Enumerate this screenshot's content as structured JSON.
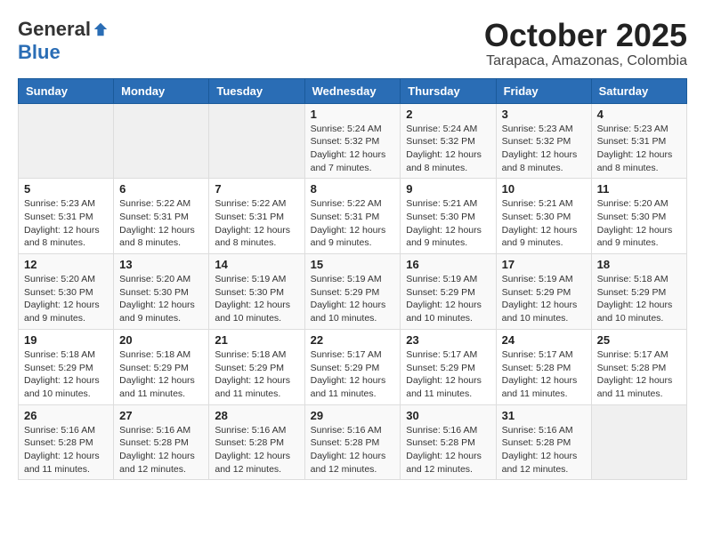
{
  "header": {
    "logo_general": "General",
    "logo_blue": "Blue",
    "month_title": "October 2025",
    "subtitle": "Tarapaca, Amazonas, Colombia"
  },
  "weekdays": [
    "Sunday",
    "Monday",
    "Tuesday",
    "Wednesday",
    "Thursday",
    "Friday",
    "Saturday"
  ],
  "weeks": [
    [
      {
        "day": "",
        "sunrise": "",
        "sunset": "",
        "daylight": ""
      },
      {
        "day": "",
        "sunrise": "",
        "sunset": "",
        "daylight": ""
      },
      {
        "day": "",
        "sunrise": "",
        "sunset": "",
        "daylight": ""
      },
      {
        "day": "1",
        "sunrise": "Sunrise: 5:24 AM",
        "sunset": "Sunset: 5:32 PM",
        "daylight": "Daylight: 12 hours and 7 minutes."
      },
      {
        "day": "2",
        "sunrise": "Sunrise: 5:24 AM",
        "sunset": "Sunset: 5:32 PM",
        "daylight": "Daylight: 12 hours and 8 minutes."
      },
      {
        "day": "3",
        "sunrise": "Sunrise: 5:23 AM",
        "sunset": "Sunset: 5:32 PM",
        "daylight": "Daylight: 12 hours and 8 minutes."
      },
      {
        "day": "4",
        "sunrise": "Sunrise: 5:23 AM",
        "sunset": "Sunset: 5:31 PM",
        "daylight": "Daylight: 12 hours and 8 minutes."
      }
    ],
    [
      {
        "day": "5",
        "sunrise": "Sunrise: 5:23 AM",
        "sunset": "Sunset: 5:31 PM",
        "daylight": "Daylight: 12 hours and 8 minutes."
      },
      {
        "day": "6",
        "sunrise": "Sunrise: 5:22 AM",
        "sunset": "Sunset: 5:31 PM",
        "daylight": "Daylight: 12 hours and 8 minutes."
      },
      {
        "day": "7",
        "sunrise": "Sunrise: 5:22 AM",
        "sunset": "Sunset: 5:31 PM",
        "daylight": "Daylight: 12 hours and 8 minutes."
      },
      {
        "day": "8",
        "sunrise": "Sunrise: 5:22 AM",
        "sunset": "Sunset: 5:31 PM",
        "daylight": "Daylight: 12 hours and 9 minutes."
      },
      {
        "day": "9",
        "sunrise": "Sunrise: 5:21 AM",
        "sunset": "Sunset: 5:30 PM",
        "daylight": "Daylight: 12 hours and 9 minutes."
      },
      {
        "day": "10",
        "sunrise": "Sunrise: 5:21 AM",
        "sunset": "Sunset: 5:30 PM",
        "daylight": "Daylight: 12 hours and 9 minutes."
      },
      {
        "day": "11",
        "sunrise": "Sunrise: 5:20 AM",
        "sunset": "Sunset: 5:30 PM",
        "daylight": "Daylight: 12 hours and 9 minutes."
      }
    ],
    [
      {
        "day": "12",
        "sunrise": "Sunrise: 5:20 AM",
        "sunset": "Sunset: 5:30 PM",
        "daylight": "Daylight: 12 hours and 9 minutes."
      },
      {
        "day": "13",
        "sunrise": "Sunrise: 5:20 AM",
        "sunset": "Sunset: 5:30 PM",
        "daylight": "Daylight: 12 hours and 9 minutes."
      },
      {
        "day": "14",
        "sunrise": "Sunrise: 5:19 AM",
        "sunset": "Sunset: 5:30 PM",
        "daylight": "Daylight: 12 hours and 10 minutes."
      },
      {
        "day": "15",
        "sunrise": "Sunrise: 5:19 AM",
        "sunset": "Sunset: 5:29 PM",
        "daylight": "Daylight: 12 hours and 10 minutes."
      },
      {
        "day": "16",
        "sunrise": "Sunrise: 5:19 AM",
        "sunset": "Sunset: 5:29 PM",
        "daylight": "Daylight: 12 hours and 10 minutes."
      },
      {
        "day": "17",
        "sunrise": "Sunrise: 5:19 AM",
        "sunset": "Sunset: 5:29 PM",
        "daylight": "Daylight: 12 hours and 10 minutes."
      },
      {
        "day": "18",
        "sunrise": "Sunrise: 5:18 AM",
        "sunset": "Sunset: 5:29 PM",
        "daylight": "Daylight: 12 hours and 10 minutes."
      }
    ],
    [
      {
        "day": "19",
        "sunrise": "Sunrise: 5:18 AM",
        "sunset": "Sunset: 5:29 PM",
        "daylight": "Daylight: 12 hours and 10 minutes."
      },
      {
        "day": "20",
        "sunrise": "Sunrise: 5:18 AM",
        "sunset": "Sunset: 5:29 PM",
        "daylight": "Daylight: 12 hours and 11 minutes."
      },
      {
        "day": "21",
        "sunrise": "Sunrise: 5:18 AM",
        "sunset": "Sunset: 5:29 PM",
        "daylight": "Daylight: 12 hours and 11 minutes."
      },
      {
        "day": "22",
        "sunrise": "Sunrise: 5:17 AM",
        "sunset": "Sunset: 5:29 PM",
        "daylight": "Daylight: 12 hours and 11 minutes."
      },
      {
        "day": "23",
        "sunrise": "Sunrise: 5:17 AM",
        "sunset": "Sunset: 5:29 PM",
        "daylight": "Daylight: 12 hours and 11 minutes."
      },
      {
        "day": "24",
        "sunrise": "Sunrise: 5:17 AM",
        "sunset": "Sunset: 5:28 PM",
        "daylight": "Daylight: 12 hours and 11 minutes."
      },
      {
        "day": "25",
        "sunrise": "Sunrise: 5:17 AM",
        "sunset": "Sunset: 5:28 PM",
        "daylight": "Daylight: 12 hours and 11 minutes."
      }
    ],
    [
      {
        "day": "26",
        "sunrise": "Sunrise: 5:16 AM",
        "sunset": "Sunset: 5:28 PM",
        "daylight": "Daylight: 12 hours and 11 minutes."
      },
      {
        "day": "27",
        "sunrise": "Sunrise: 5:16 AM",
        "sunset": "Sunset: 5:28 PM",
        "daylight": "Daylight: 12 hours and 12 minutes."
      },
      {
        "day": "28",
        "sunrise": "Sunrise: 5:16 AM",
        "sunset": "Sunset: 5:28 PM",
        "daylight": "Daylight: 12 hours and 12 minutes."
      },
      {
        "day": "29",
        "sunrise": "Sunrise: 5:16 AM",
        "sunset": "Sunset: 5:28 PM",
        "daylight": "Daylight: 12 hours and 12 minutes."
      },
      {
        "day": "30",
        "sunrise": "Sunrise: 5:16 AM",
        "sunset": "Sunset: 5:28 PM",
        "daylight": "Daylight: 12 hours and 12 minutes."
      },
      {
        "day": "31",
        "sunrise": "Sunrise: 5:16 AM",
        "sunset": "Sunset: 5:28 PM",
        "daylight": "Daylight: 12 hours and 12 minutes."
      },
      {
        "day": "",
        "sunrise": "",
        "sunset": "",
        "daylight": ""
      }
    ]
  ]
}
